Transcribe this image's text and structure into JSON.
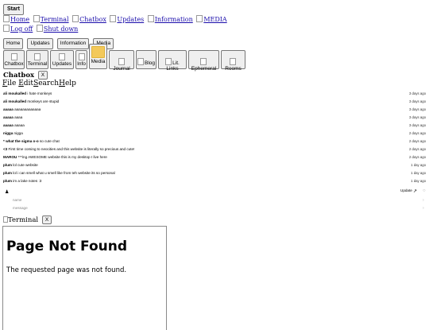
{
  "start_label": "Start",
  "nav_links": [
    "Home",
    "Terminal",
    "Chatbox",
    "Updates",
    "Information",
    "MEDIA"
  ],
  "session_links": [
    "Log off",
    "Shut down"
  ],
  "page_buttons": [
    "Home",
    "Updates",
    "Information",
    "Media"
  ],
  "icon_buttons": [
    "Chatbox",
    "Terminal",
    "Updates",
    "Info",
    "Media",
    "Journal",
    "Blog",
    "Lit. Links",
    "Ephemeral",
    "Rooms"
  ],
  "chat": {
    "title": "Chatbox",
    "close": "X",
    "menu": [
      "File",
      "Edit",
      "Search",
      "Help"
    ],
    "messages": [
      {
        "who": "ali moukalled",
        "text": "i hate monkeys",
        "time": "3 days ago"
      },
      {
        "who": "ali moukalled",
        "text": "monkeys are stupid",
        "time": "3 days ago"
      },
      {
        "who": "aaaaa",
        "text": "aaaaaaaaaaaaa",
        "time": "3 days ago"
      },
      {
        "who": "aaaaa",
        "text": "aaaa",
        "time": "3 days ago"
      },
      {
        "who": "aaaaa",
        "text": "aaaaa",
        "time": "3 days ago"
      },
      {
        "who": "nigga",
        "text": "nigga",
        "time": "2 days ago"
      },
      {
        "who": "* what the sigma o-o",
        "text": "so cute chat",
        "time": "2 days ago"
      },
      {
        "who": "<3",
        "text": "First time coming to neocities and this website is literally so precious and cute!",
        "time": "2 days ago"
      },
      {
        "who": "MAROU",
        "text": "***ing AWESOME website this is my desktop I live here",
        "time": "2 days ago"
      },
      {
        "who": "plum",
        "text": "lol cute website",
        "time": "1 day ago"
      },
      {
        "who": "plum",
        "text": "lol i can smell what u smell like from teh website its so personal",
        "time": "1 day ago"
      },
      {
        "who": "plum",
        "text": "im a lake notes :3",
        "time": "1 day ago"
      }
    ],
    "update_label": "Update",
    "name_placeholder": "name",
    "message_placeholder": "message"
  },
  "terminal": {
    "title": "Terminal",
    "close": "X",
    "heading": "Page Not Found",
    "body": "The requested page was not found."
  }
}
